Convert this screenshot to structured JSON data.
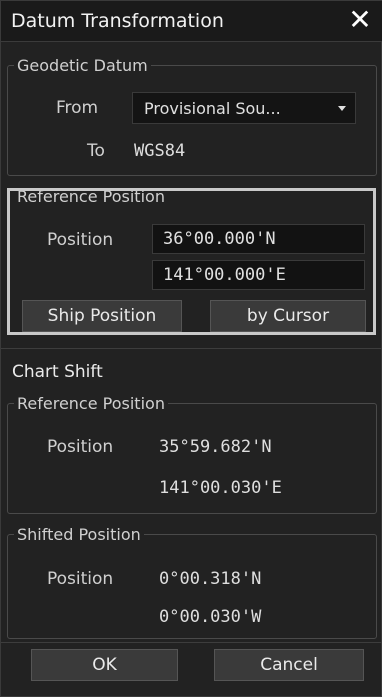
{
  "dialog": {
    "title": "Datum Transformation",
    "close_symbol": "✕"
  },
  "geodetic": {
    "legend": "Geodetic Datum",
    "from_label": "From",
    "from_value": "Provisional Sou...",
    "to_label": "To",
    "to_value": "WGS84"
  },
  "reference": {
    "legend": "Reference Position",
    "position_label": "Position",
    "lat": "36°00.000'N",
    "lon": "141°00.000'E",
    "ship_button": "Ship Position",
    "cursor_button": "by Cursor"
  },
  "chart_shift": {
    "title": "Chart Shift",
    "ref_legend": "Reference Position",
    "ref_label": "Position",
    "ref_lat": "35°59.682'N",
    "ref_lon": "141°00.030'E",
    "shift_legend": "Shifted Position",
    "shift_label": "Position",
    "shift_lat": "0°00.318'N",
    "shift_lon": "0°00.030'W"
  },
  "footer": {
    "ok": "OK",
    "cancel": "Cancel"
  },
  "icons": {
    "close": "close-icon",
    "dropdown": "chevron-down-icon"
  }
}
